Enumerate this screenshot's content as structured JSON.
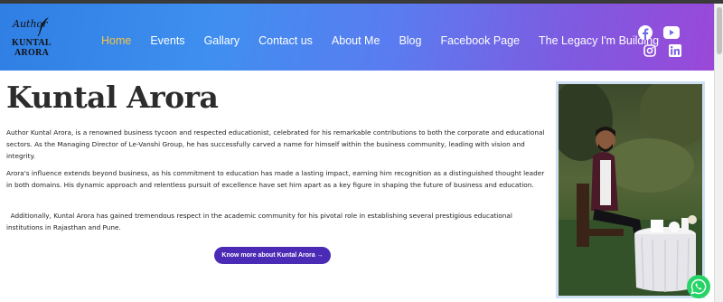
{
  "header": {
    "logo": {
      "script_text": "Author",
      "line1": "KUNTAL",
      "line2": "ARORA"
    },
    "nav": [
      {
        "label": "Home",
        "active": true
      },
      {
        "label": "Events"
      },
      {
        "label": "Gallary"
      },
      {
        "label": "Contact us"
      },
      {
        "label": "About Me"
      },
      {
        "label": "Blog"
      },
      {
        "label": "Facebook Page"
      },
      {
        "label": "The Legacy I'm Building"
      }
    ],
    "social_icons": [
      "facebook-icon",
      "youtube-icon",
      "instagram-icon",
      "linkedin-icon"
    ],
    "gradient_start": "#2f7fe4",
    "gradient_end": "#9a48d8",
    "active_color": "#f5c542"
  },
  "main": {
    "title": "Kuntal Arora",
    "paragraphs": [
      "Author Kuntal Arora, is a renowned business tycoon and respected educationist, celebrated for his remarkable contributions to both the corporate and educational sectors. As the Managing Director of Le-Vanshi Group, he has successfully carved a name for himself within the business community, leading with vision and integrity.",
      "Arora's influence extends beyond business, as his commitment to education has made a lasting impact, earning him recognition as a distinguished thought leader in both domains. His dynamic approach and relentless pursuit of excellence have set him apart as a key figure in shaping the future of business and education.",
      "  Additionally, Kuntal Arora has gained tremendous respect in the academic community for his pivotal role in establishing several prestigious educational institutions in Rajasthan and Pune."
    ],
    "cta_label": "Know more about Kuntal Arora →",
    "cta_color": "#4b2bb5"
  },
  "floating": {
    "whatsapp_icon": "whatsapp-icon",
    "whatsapp_color": "#25d366"
  }
}
